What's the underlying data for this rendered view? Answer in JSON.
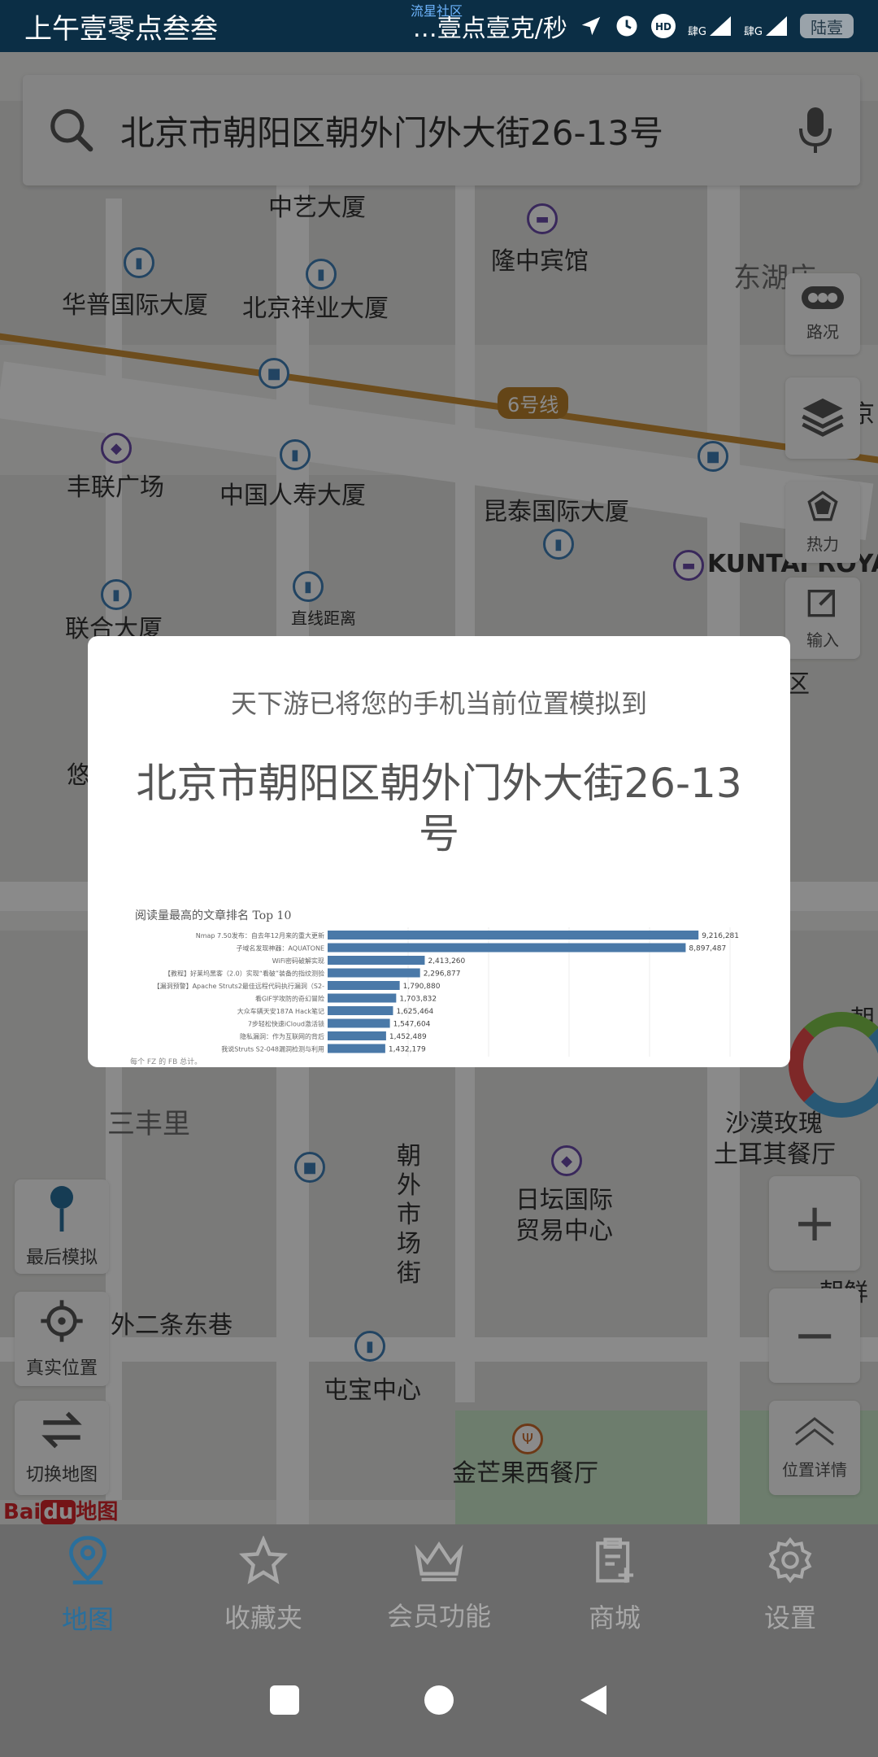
{
  "status_bar": {
    "time": "上午壹零点叁叁",
    "community": "流星社区",
    "network_speed": "…壹点壹克/秒",
    "hd": "HD",
    "sim1": "肆G",
    "sim2": "肆G",
    "battery": "陆壹"
  },
  "search": {
    "value": "北京市朝阳区朝外门外大街26-13号"
  },
  "map": {
    "labels": [
      "中艺大厦",
      "隆中宾馆",
      "东湖庙",
      "华普国际大厦",
      "北京祥业大厦",
      "丰联广场",
      "中国人寿大厦",
      "昆泰国际大厦",
      "KUNTAI ROYAL",
      "联合大厦",
      "三丰里",
      "沙漠玫瑰",
      "土耳其餐厅",
      "日坛国际",
      "贸易中心",
      "朝外市场街",
      "外二条东巷",
      "屯宝中心",
      "金芒果西餐厅",
      "区",
      "京",
      "朝",
      "朝鲜",
      "悠",
      "直线距离"
    ],
    "line_badge": "6号线"
  },
  "side_controls": {
    "traffic": "路况",
    "heat": "热力",
    "input": "输入",
    "location_detail": "位置详情"
  },
  "left_controls": {
    "last_sim": "最后模拟",
    "real_location": "真实位置",
    "switch_map": "切换地图"
  },
  "baidu": {
    "brand": "Bai",
    "brand2": "du",
    "brand3": "地图"
  },
  "dialog": {
    "subtitle": "天下游已将您的手机当前位置模拟到",
    "address": "北京市朝阳区朝外门外大街26-13号"
  },
  "chart_data": {
    "type": "bar",
    "title": "阅读量最高的文章排名 Top 10",
    "orientation": "horizontal",
    "categories": [
      "Nmap 7.50发布：自去年12月来的重大更新",
      "子域名发现神器：AQUATONE",
      "WiFi密码破解实现",
      "【教程】好莱坞黑客（2.0）实现“看破”装备的指纹测验",
      "【漏洞预警】Apache Struts2最佳远程代码执行漏洞（S2-",
      "看GIF学攻防的奇幻冒险",
      "大众车辆天安187A Hack笔记",
      "7步轻松快速iCloud激活锁",
      "隐私漏洞：作为互联网的背后",
      "我说Struts S2-048漏洞检测与利用"
    ],
    "values": [
      9216281,
      8897487,
      2413260,
      2296877,
      1790880,
      1703832,
      1625464,
      1547604,
      1452489,
      1432179
    ],
    "value_labels": [
      "9,216,281",
      "8,897,487",
      "2,413,260",
      "2,296,877",
      "1,790,880",
      "1,703,832",
      "1,625,464",
      "1,547,604",
      "1,452,489",
      "1,432,179"
    ],
    "footer": "每个 FZ 的 FB 总计。",
    "bar_color": "#4a79a8",
    "xlim": [
      0,
      10000000
    ]
  },
  "bottom_nav": [
    {
      "label": "地图",
      "icon": "map-pin-icon",
      "active": true
    },
    {
      "label": "收藏夹",
      "icon": "star-icon",
      "active": false
    },
    {
      "label": "会员功能",
      "icon": "crown-icon",
      "active": false
    },
    {
      "label": "商城",
      "icon": "clipboard-plus-icon",
      "active": false
    },
    {
      "label": "设置",
      "icon": "gear-icon",
      "active": false
    }
  ],
  "colors": {
    "accent": "#2a6f9c",
    "status_bar": "#0b2e45",
    "nav_bg": "#6b6b6b"
  }
}
